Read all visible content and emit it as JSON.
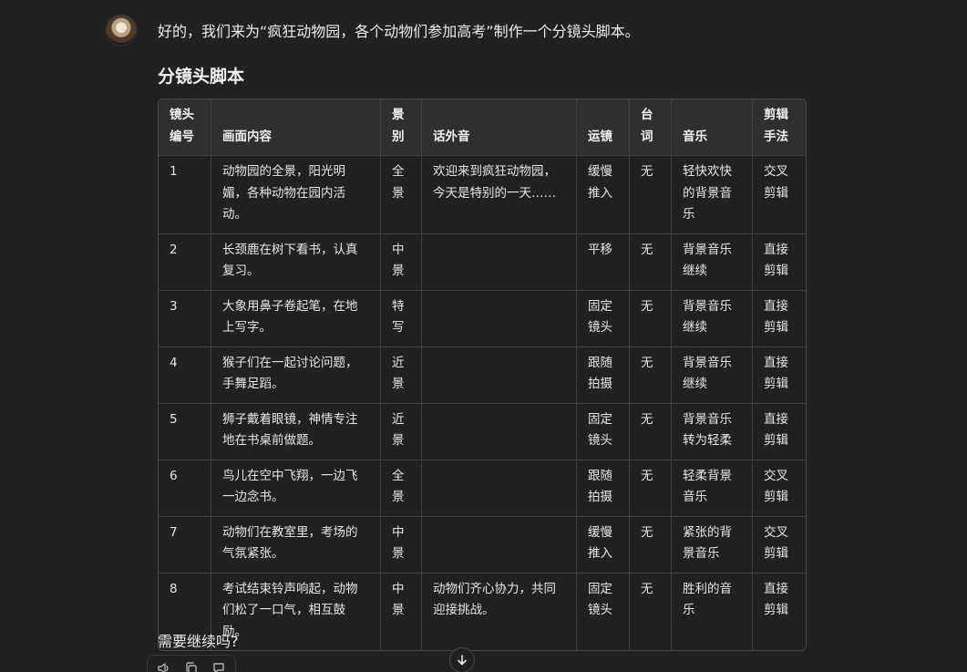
{
  "message": {
    "intro": "好的，我们来为“疯狂动物园，各个动物们参加高考”制作一个分镜头脚本。",
    "title": "分镜头脚本",
    "follow_up": "需要继续吗?"
  },
  "table": {
    "headers": [
      "镜头编号",
      "画面内容",
      "景别",
      "话外音",
      "运镜",
      "台词",
      "音乐",
      "剪辑手法"
    ],
    "rows": [
      [
        "1",
        "动物园的全景，阳光明媚，各种动物在园内活动。",
        "全景",
        "欢迎来到疯狂动物园，今天是特别的一天……",
        "缓慢推入",
        "无",
        "轻快欢快的背景音乐",
        "交叉剪辑"
      ],
      [
        "2",
        "长颈鹿在树下看书，认真复习。",
        "中景",
        "",
        "平移",
        "无",
        "背景音乐继续",
        "直接剪辑"
      ],
      [
        "3",
        "大象用鼻子卷起笔，在地上写字。",
        "特写",
        "",
        "固定镜头",
        "无",
        "背景音乐继续",
        "直接剪辑"
      ],
      [
        "4",
        "猴子们在一起讨论问题，手舞足蹈。",
        "近景",
        "",
        "跟随拍摄",
        "无",
        "背景音乐继续",
        "直接剪辑"
      ],
      [
        "5",
        "狮子戴着眼镜，神情专注地在书桌前做题。",
        "近景",
        "",
        "固定镜头",
        "无",
        "背景音乐转为轻柔",
        "直接剪辑"
      ],
      [
        "6",
        "鸟儿在空中飞翔，一边飞一边念书。",
        "全景",
        "",
        "跟随拍摄",
        "无",
        "轻柔背景音乐",
        "交叉剪辑"
      ],
      [
        "7",
        "动物们在教室里，考场的气氛紧张。",
        "中景",
        "",
        "缓慢推入",
        "无",
        "紧张的背景音乐",
        "交叉剪辑"
      ],
      [
        "8",
        "考试结束铃声响起，动物们松了一口气，相互鼓励。",
        "中景",
        "动物们齐心协力，共同迎接挑战。",
        "固定镜头",
        "无",
        "胜利的音乐",
        "直接剪辑"
      ]
    ]
  },
  "icons": {
    "avatar": "user-avatar",
    "actions": [
      "speaker-icon",
      "copy-icon",
      "feedback-icon"
    ],
    "scroll": "arrow-down-icon"
  }
}
